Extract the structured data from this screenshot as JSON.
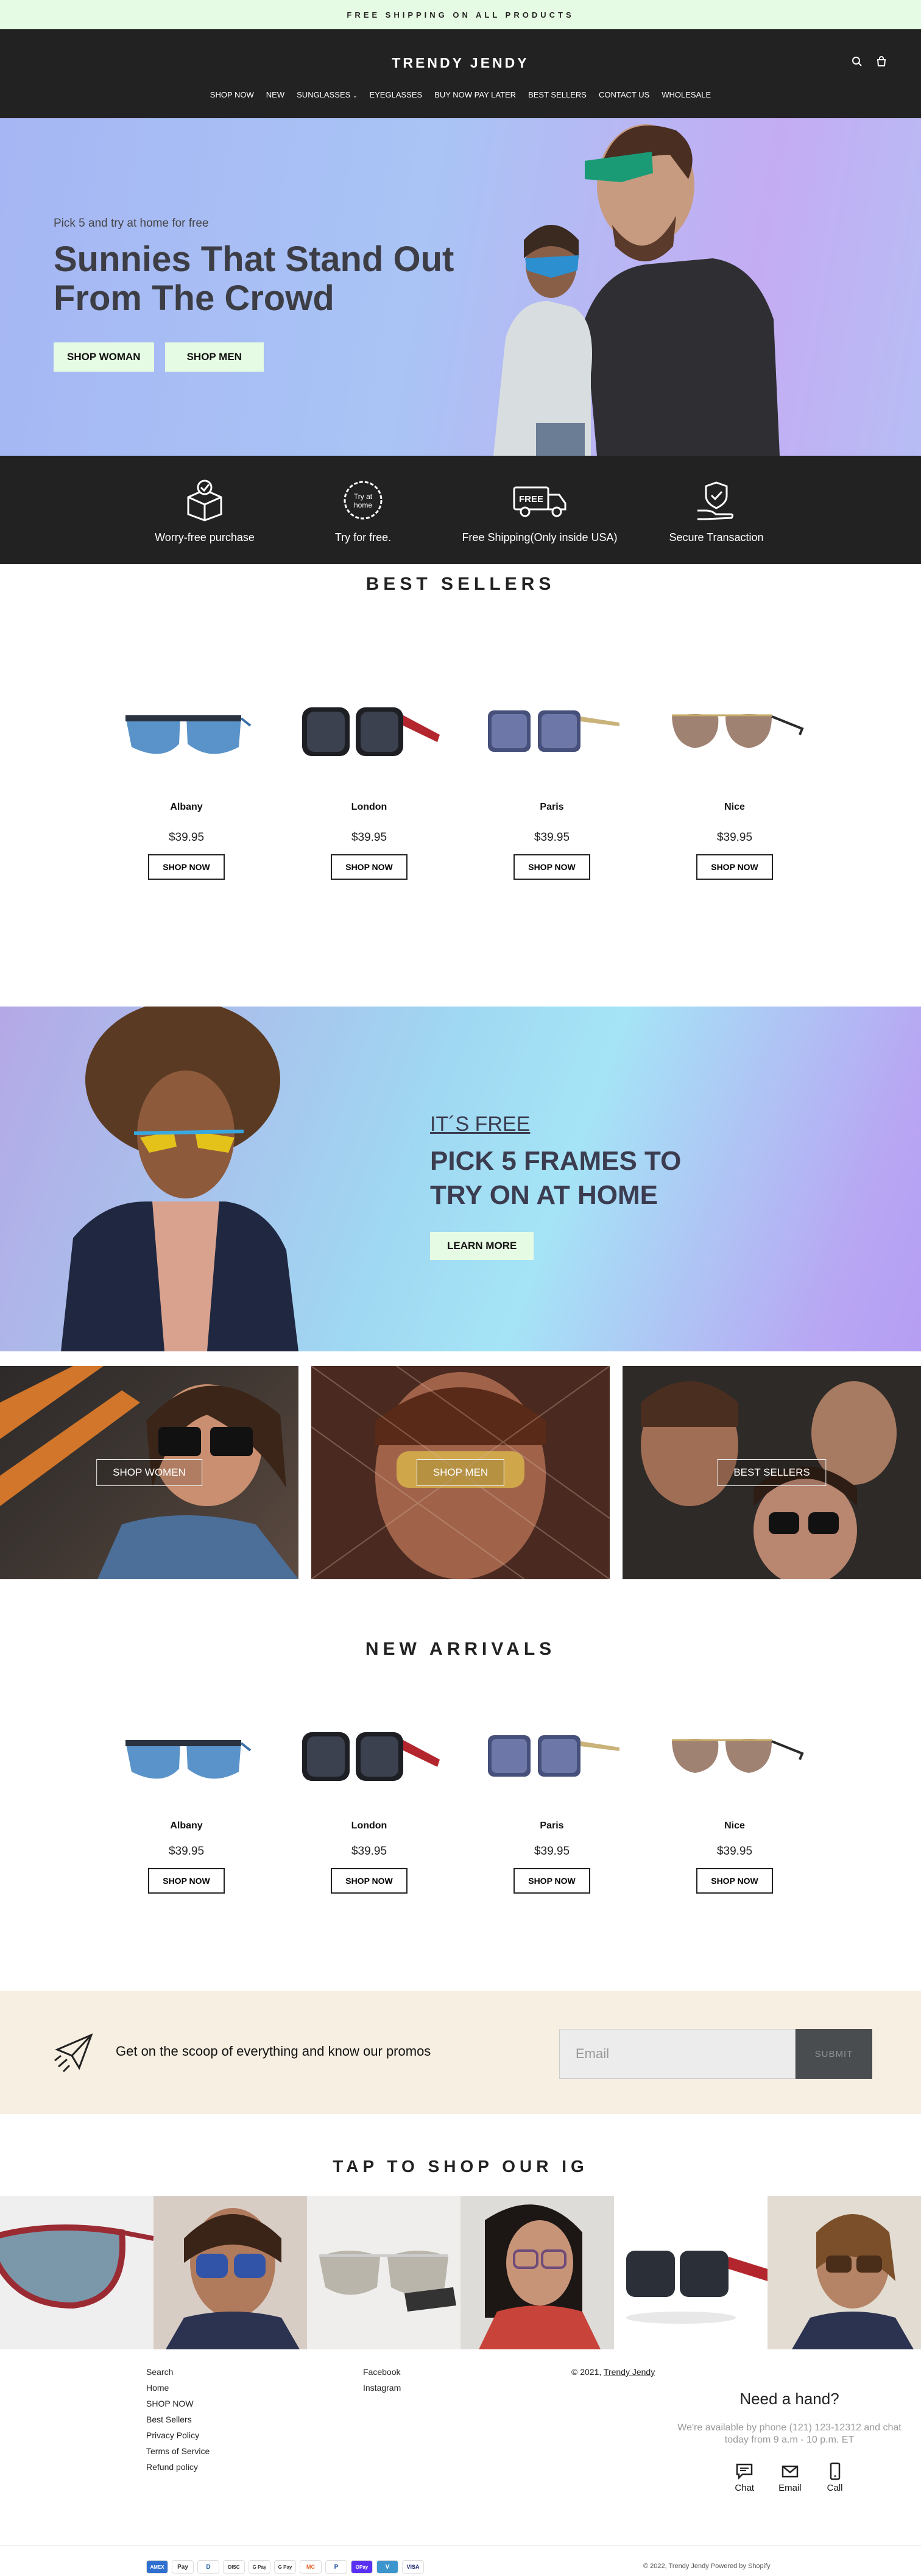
{
  "announcement": "FREE SHIPPING ON ALL PRODUCTS",
  "brand": "TRENDY JENDY",
  "nav": [
    "SHOP NOW",
    "NEW",
    "SUNGLASSES",
    "EYEGLASSES",
    "BUY NOW PAY LATER",
    "BEST SELLERS",
    "CONTACT US",
    "WHOLESALE"
  ],
  "hero": {
    "subtitle": "Pick 5 and try at home for free",
    "title": "Sunnies That Stand Out From The Crowd",
    "btn_women": "SHOP WOMAN",
    "btn_men": "SHOP MEN"
  },
  "features": [
    {
      "label": "Worry-free purchase",
      "icon": "box-check-icon"
    },
    {
      "label": "Try for free.",
      "icon": "try-at-home-badge-icon",
      "badge": "Try at home"
    },
    {
      "label": "Free Shipping(Only inside USA)",
      "icon": "free-truck-icon",
      "badge": "FREE"
    },
    {
      "label": "Secure Transaction",
      "icon": "secure-hand-shield-icon"
    }
  ],
  "best_sellers": {
    "title": "BEST SELLERS",
    "products": [
      {
        "name": "Albany",
        "price": "$39.95",
        "cta": "SHOP NOW"
      },
      {
        "name": "London",
        "price": "$39.95",
        "cta": "SHOP NOW"
      },
      {
        "name": "Paris",
        "price": "$39.95",
        "cta": "SHOP NOW"
      },
      {
        "name": "Nice",
        "price": "$39.95",
        "cta": "SHOP NOW"
      }
    ]
  },
  "promo": {
    "kicker": "IT´S FREE",
    "title": "PICK 5 FRAMES TO TRY ON AT HOME",
    "cta": "LEARN MORE"
  },
  "categories": [
    "SHOP WOMEN",
    "SHOP MEN",
    "BEST SELLERS"
  ],
  "new_arrivals": {
    "title": "NEW ARRIVALS",
    "products": [
      {
        "name": "Albany",
        "price": "$39.95",
        "cta": "SHOP NOW"
      },
      {
        "name": "London",
        "price": "$39.95",
        "cta": "SHOP NOW"
      },
      {
        "name": "Paris",
        "price": "$39.95",
        "cta": "SHOP NOW"
      },
      {
        "name": "Nice",
        "price": "$39.95",
        "cta": "SHOP NOW"
      }
    ]
  },
  "newsletter": {
    "text": "Get on the scoop of everything and know our promos",
    "placeholder": "Email",
    "submit": "SUBMIT"
  },
  "ig": {
    "title": "TAP TO SHOP OUR IG"
  },
  "footer": {
    "col1": [
      "Search",
      "Home",
      "SHOP NOW",
      "Best Sellers",
      "Privacy Policy",
      "Terms of Service",
      "Refund policy"
    ],
    "col2": [
      "Facebook",
      "Instagram"
    ],
    "copyright_prefix": "© 2021,",
    "copyright_link": "Trendy Jendy",
    "help_title": "Need a hand?",
    "help_text": "We're available by phone (121) 123-12312 and chat today from 9 a.m - 10 p.m. ET",
    "contact": [
      "Chat",
      "Email",
      "Call"
    ],
    "payments": [
      "AMEX",
      "Pay",
      "D",
      "DISC",
      "G Pay",
      "G Pay",
      "MC",
      "P",
      "OPay",
      "V",
      "VISA"
    ],
    "bottom_copy": "© 2022, Trendy Jendy Powered by Shopify"
  },
  "colors": {
    "mint": "#e6fbe3",
    "dark": "#222222",
    "cream": "#f7efe2"
  }
}
